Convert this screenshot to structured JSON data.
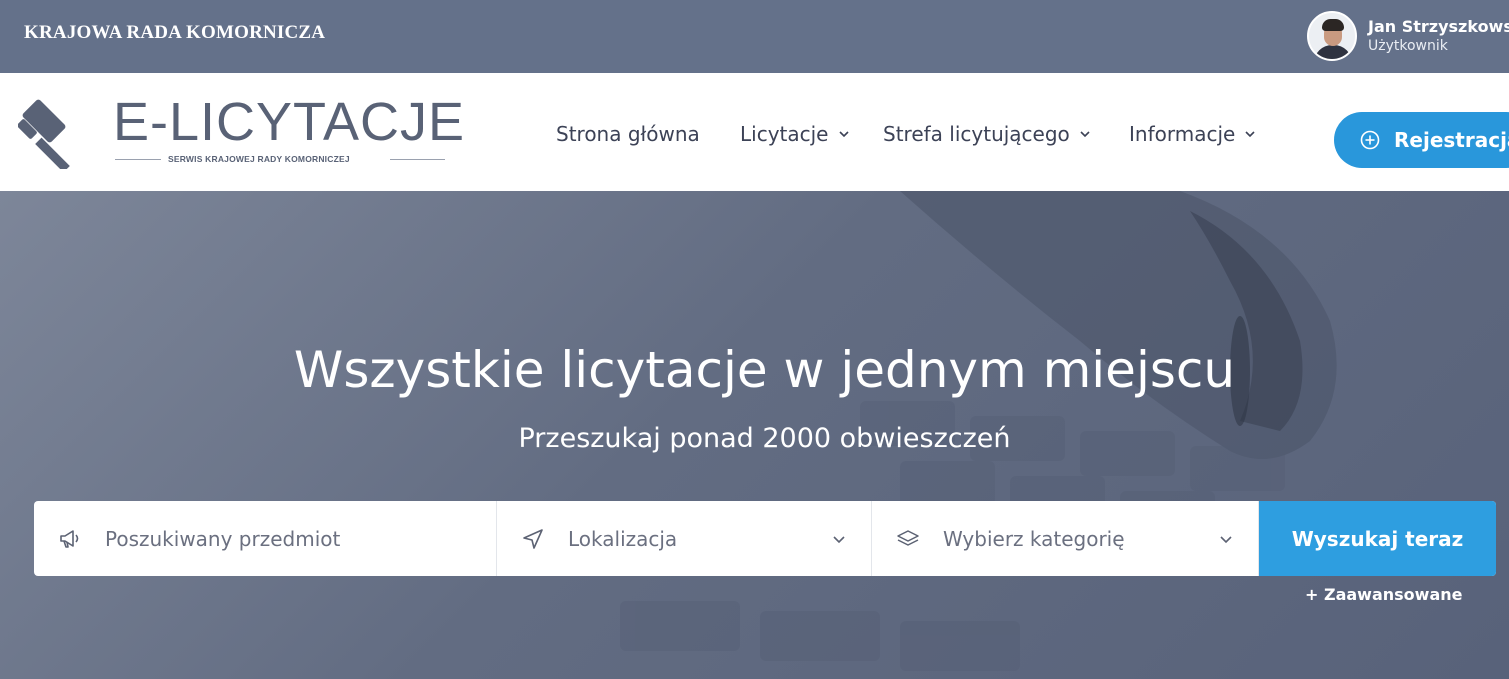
{
  "topbar": {
    "org_name": "KRAJOWA RADA KOMORNICZA",
    "user_name": "Jan Strzyszkowski",
    "user_role": "Użytkownik"
  },
  "header": {
    "logo_title": "E-LICYTACJE",
    "logo_subtitle": "SERWIS KRAJOWEJ RADY KOMORNICZEJ",
    "nav": [
      {
        "label": "Strona główna",
        "has_dropdown": false
      },
      {
        "label": "Licytacje",
        "has_dropdown": true
      },
      {
        "label": "Strefa licytującego",
        "has_dropdown": true
      },
      {
        "label": "Informacje",
        "has_dropdown": true
      }
    ],
    "register_label": "Rejestracja"
  },
  "hero": {
    "title": "Wszystkie licytacje w jednym miejscu",
    "subtitle": "Przeszukaj ponad 2000 obwieszczeń"
  },
  "search": {
    "item_placeholder": "Poszukiwany przedmiot",
    "location_placeholder": "Lokalizacja",
    "category_placeholder": "Wybierz kategorię",
    "button_label": "Wyszukaj teraz",
    "advanced_label": "+  Zaawansowane"
  },
  "colors": {
    "topbar_bg": "#64718a",
    "accent_blue": "#2997db",
    "nav_text": "#3c4256"
  },
  "icons": {
    "logo": "gavel-icon",
    "register": "plus-circle-icon",
    "item": "megaphone-icon",
    "location": "navigation-arrow-icon",
    "category": "layers-icon",
    "dropdown": "chevron-down-icon"
  }
}
